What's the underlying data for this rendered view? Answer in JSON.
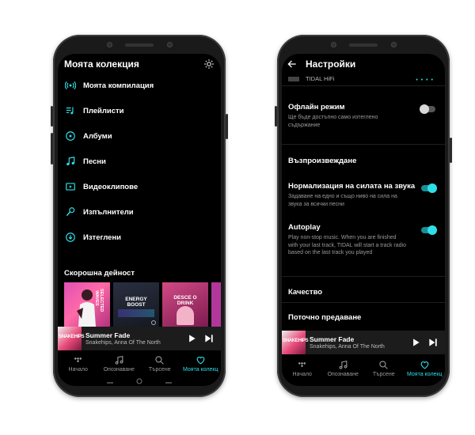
{
  "left_screen": {
    "title": "Моята колекция",
    "menu": [
      {
        "label": "Моята компилация",
        "icon": "radio-icon"
      },
      {
        "label": "Плейлисти",
        "icon": "playlist-icon"
      },
      {
        "label": "Албуми",
        "icon": "album-icon"
      },
      {
        "label": "Песни",
        "icon": "music-note-icon"
      },
      {
        "label": "Видеоклипове",
        "icon": "video-icon"
      },
      {
        "label": "Изпълнители",
        "icon": "microphone-icon"
      },
      {
        "label": "Изтеглени",
        "icon": "download-icon"
      }
    ],
    "recent_title": "Скорошна дейност",
    "tiles": [
      {
        "text": "SELECTED WAVES"
      },
      {
        "text": "ENERGY BOOST"
      },
      {
        "text": "DESCE O DRINK"
      }
    ],
    "player": {
      "title": "Summer Fade",
      "artist": "Snakehips, Anna Of The North",
      "cover_text": "SNAKEHIPS"
    }
  },
  "right_screen": {
    "title": "Настройки",
    "hifi_label": "TIDAL HiFi",
    "offline": {
      "title": "Офлайн режим",
      "desc": "Ще бъде достъпно само изтеглено съдържание",
      "enabled": false
    },
    "section_playback": "Възпроизвеждане",
    "normalization": {
      "title": "Нормализация на силата на звука",
      "desc": "Задаване на едно и също ниво на сила на звука за всички песни",
      "enabled": true
    },
    "autoplay": {
      "title": "Autoplay",
      "desc": "Play non-stop music. When you are finished with your last track, TIDAL will start a track radio based on the last track you played",
      "enabled": true
    },
    "section_quality": "Качество",
    "section_streaming": "Поточно предаване",
    "player": {
      "title": "Summer Fade",
      "artist": "Snakehips, Anna Of The North",
      "cover_text": "SNAKEHIPS"
    }
  },
  "nav": {
    "home": "Начало",
    "explore": "Опознаване",
    "search": "Търсене",
    "collection": "Моята колекц"
  },
  "colors": {
    "accent": "#2de0e8",
    "screen_bg": "#000000",
    "player_bg": "#1c1c1c"
  }
}
